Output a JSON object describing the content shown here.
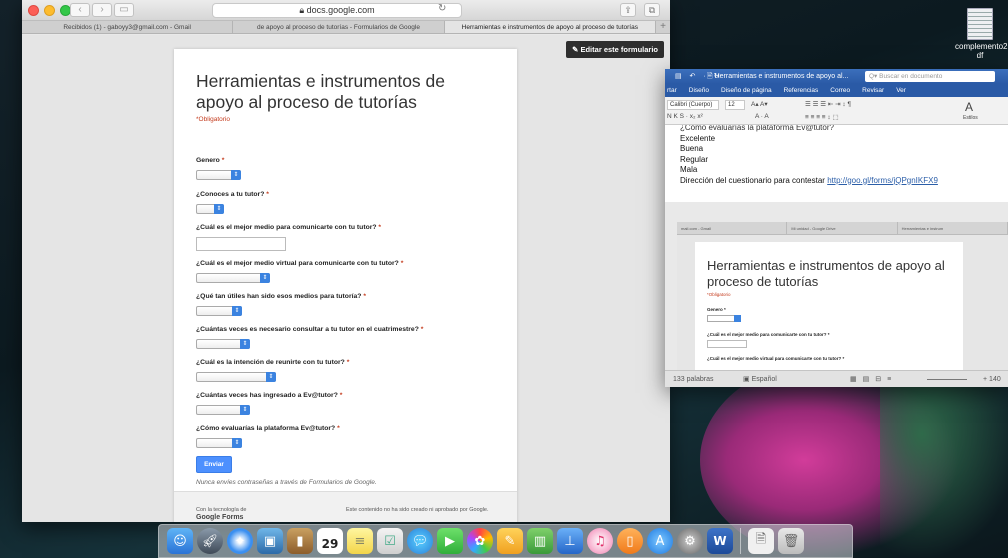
{
  "desktop": {
    "file_label_1": "complemento2",
    "file_label_2": "df"
  },
  "safari": {
    "url": "docs.google.com",
    "tabs": [
      {
        "label": "Recibidos (1) - gaboyy3@gmail.com - Gmail"
      },
      {
        "label": "de apoyo al proceso de tutorías - Formularios de Google"
      },
      {
        "label": "Herramientas e instrumentos de apoyo al proceso de tutorías"
      }
    ]
  },
  "form": {
    "edit_button": "✎ Editar este formulario",
    "title": "Herramientas e instrumentos de apoyo al proceso de tutorías",
    "required_note": "*Obligatorio",
    "questions": [
      {
        "label": "Genero",
        "required": "*"
      },
      {
        "label": "¿Conoces a tu tutor?",
        "required": "*"
      },
      {
        "label": "¿Cuál es el mejor medio para comunicarte con tu tutor?",
        "required": "*"
      },
      {
        "label": "¿Cuál es el mejor medio virtual para comunicarte con tu tutor?",
        "required": "*"
      },
      {
        "label": "¿Qué tan útiles han sido esos medios para tutoría?",
        "required": "*"
      },
      {
        "label": "¿Cuántas veces es necesario consultar a tu tutor en el cuatrimestre?",
        "required": "*"
      },
      {
        "label": "¿Cuál es la intención de reunirte con tu tutor?",
        "required": "*"
      },
      {
        "label": "¿Cuántas veces has ingresado a Ev@tutor?",
        "required": "*"
      },
      {
        "label": "¿Cómo evaluarías la plataforma Ev@tutor?",
        "required": "*"
      }
    ],
    "submit": "Enviar",
    "password_note": "Nunca envíes contraseñas a través de Formularios de Google.",
    "footer_left_1": "Con la tecnología de",
    "footer_left_2": "Google Forms",
    "footer_right": "Este contenido no ha sido creado ni aprobado por Google."
  },
  "word": {
    "quick_access": "▤ ↶ · ↻",
    "title": "Herramientas e instrumentos de apoyo al...",
    "search_placeholder": "Q▾ Buscar en documento",
    "ribbon_tabs": [
      "rtar",
      "Diseño",
      "Diseño de página",
      "Referencias",
      "Correo",
      "Revisar",
      "Ver"
    ],
    "font_name": "Calibri (Cuerpo)",
    "font_size": "12",
    "styles_label": "Estilos",
    "doc_lines": {
      "cut": "¿Cómo evaluarías la plataforma Ev@tutor?",
      "l1": "Excelente",
      "l2": "Buena",
      "l3": "Regular",
      "l4": "Mala",
      "l5_text": "Dirección del cuestionario para contestar ",
      "l5_link": "http://goo.gl/forms/jQPgnIKFX9"
    },
    "screenshot": {
      "tabs": [
        "mail.com - Gmail",
        "Mi unidad - Google Drive",
        "Herramientas e instrum"
      ],
      "title": "Herramientas e instrumentos de apoyo al proceso de tutorías",
      "required_note": "*Obligatorio",
      "q1": "Genero *",
      "q2": "¿Cuál es el mejor medio para comunicarte con tu tutor? *",
      "q3": "¿Cuál es el mejor medio virtual para comunicarte con tu tutor? *"
    },
    "status": {
      "word_count": "133 palabras",
      "language": "Español",
      "zoom": "140"
    }
  },
  "dock": {
    "calendar_day": "29"
  }
}
